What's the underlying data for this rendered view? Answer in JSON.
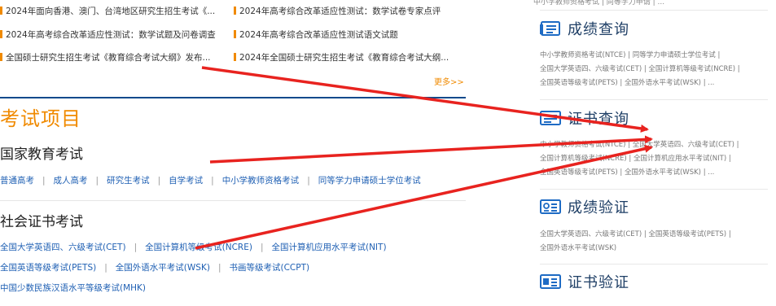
{
  "news": {
    "col1": [
      "2024年面向香港、澳门、台湾地区研究生招生考试《...",
      "2024年高考综合改革适应性测试：数学试题及问卷调查",
      "全国硕士研究生招生考试《教育综合考试大纲》发布..."
    ],
    "col2": [
      "2024年高考综合改革适应性测试：数学试卷专家点评",
      "2024年高考综合改革适应性测试语文试题",
      "2024年全国硕士研究生招生考试《教育综合考试大纲..."
    ],
    "more": "更多>>"
  },
  "exam": {
    "title": "考试项目",
    "national": {
      "title": "国家教育考试",
      "links": [
        "普通高考",
        "成人高考",
        "研究生考试",
        "自学考试",
        "中小学教师资格考试",
        "同等学力申请硕士学位考试"
      ]
    },
    "social": {
      "title": "社会证书考试",
      "row1": [
        "全国大学英语四、六级考试(CET)",
        "全国计算机等级考试(NCRE)",
        "全国计算机应用水平考试(NIT)"
      ],
      "row2": [
        "全国英语等级考试(PETS)",
        "全国外语水平考试(WSK)",
        "书画等级考试(CCPT)"
      ],
      "row3": [
        "中国少数民族汉语水平等级考试(MHK)"
      ]
    },
    "sep": "|"
  },
  "sidebar": {
    "top_text": "中小学教师资格考试 | 同等学力申请 | ...",
    "cards": [
      {
        "title": "成绩查询",
        "icon": "score-query-icon",
        "lines": [
          "中小学教师资格考试(NTCE) | 同等学力申请硕士学位考试 |",
          "全国大学英语四、六级考试(CET) | 全国计算机等级考试(NCRE) |",
          "全国英语等级考试(PETS) | 全国外语水平考试(WSK) | ..."
        ]
      },
      {
        "title": "证书查询",
        "icon": "certificate-query-icon",
        "lines": [
          "中小学教师资格考试(NTCE) | 全国大学英语四、六级考试(CET) |",
          "全国计算机等级考试(NCRE) | 全国计算机应用水平考试(NIT) |",
          "全国英语等级考试(PETS) | 全国外语水平考试(WSK) | ..."
        ]
      },
      {
        "title": "成绩验证",
        "icon": "score-verify-icon",
        "lines": [
          "全国大学英语四、六级考试(CET) | 全国英语等级考试(PETS) |",
          "全国外语水平考试(WSK)"
        ]
      },
      {
        "title": "证书验证",
        "icon": "certificate-verify-icon",
        "lines": []
      }
    ]
  },
  "colors": {
    "accent": "#f08a00",
    "link": "#1e5fb3",
    "navy": "#0d4a8c",
    "arrow": "#e8231f"
  }
}
